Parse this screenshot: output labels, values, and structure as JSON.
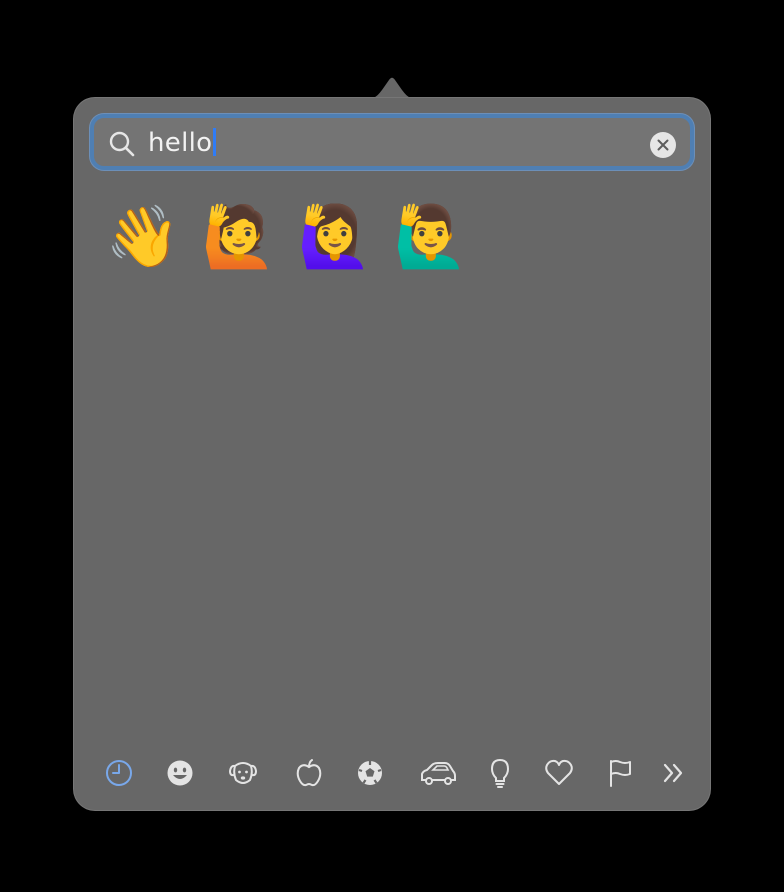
{
  "search": {
    "query": "hello"
  },
  "results": [
    {
      "name": "waving-hand-emoji",
      "glyph": "👋"
    },
    {
      "name": "person-raising-hand-emoji",
      "glyph": "🙋"
    },
    {
      "name": "woman-raising-hand-emoji",
      "glyph": "🙋‍♀️"
    },
    {
      "name": "man-raising-hand-emoji",
      "glyph": "🙋‍♂️"
    }
  ],
  "categories": [
    {
      "name": "recent-icon",
      "selected": true
    },
    {
      "name": "smileys-icon",
      "selected": false
    },
    {
      "name": "animals-icon",
      "selected": false
    },
    {
      "name": "food-icon",
      "selected": false
    },
    {
      "name": "activity-icon",
      "selected": false
    },
    {
      "name": "travel-icon",
      "selected": false
    },
    {
      "name": "objects-icon",
      "selected": false
    },
    {
      "name": "symbols-icon",
      "selected": false
    },
    {
      "name": "flags-icon",
      "selected": false
    },
    {
      "name": "more-categories-icon",
      "selected": false
    }
  ],
  "colors": {
    "panel": "#676767",
    "search_field": "#747474",
    "focus_ring": "#4f7fb3",
    "caret": "#2f7cf6",
    "selected_category": "#79a8ea",
    "icon": "#e4e4e4"
  }
}
